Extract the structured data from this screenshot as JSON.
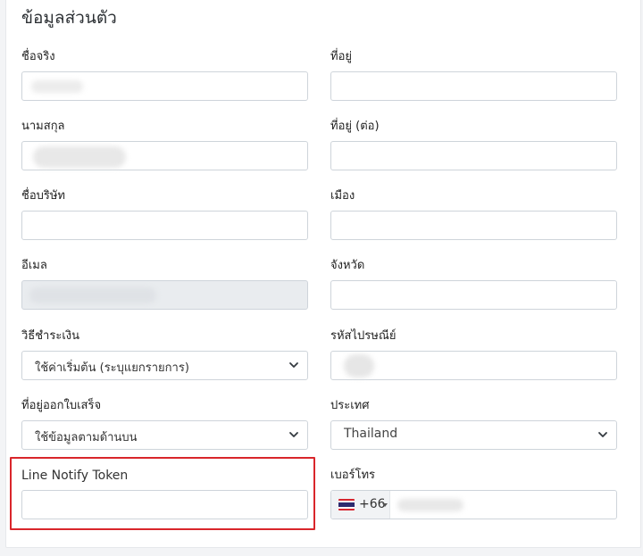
{
  "section_title": "ข้อมูลส่วนตัว",
  "fields": {
    "first_name": {
      "label": "ชื่อจริง",
      "value": ""
    },
    "last_name": {
      "label": "นามสกุล",
      "value": ""
    },
    "company": {
      "label": "ชื่อบริษัท",
      "value": ""
    },
    "email": {
      "label": "อีเมล",
      "value": ""
    },
    "payment_method": {
      "label": "วิธีชำระเงิน",
      "selected": "ใช้ค่าเริ่มต้น (ระบุแยกรายการ)"
    },
    "invoice_address": {
      "label": "ที่อยู่ออกใบเสร็จ",
      "selected": "ใช้ข้อมูลตามด้านบน"
    },
    "line_token": {
      "label": "Line Notify Token",
      "value": ""
    },
    "address1": {
      "label": "ที่อยู่",
      "value": ""
    },
    "address2": {
      "label": "ที่อยู่ (ต่อ)",
      "value": ""
    },
    "city": {
      "label": "เมือง",
      "value": ""
    },
    "province": {
      "label": "จังหวัด",
      "value": ""
    },
    "postcode": {
      "label": "รหัสไปรษณีย์",
      "value": ""
    },
    "country": {
      "label": "ประเทศ",
      "selected": "Thailand"
    },
    "phone": {
      "label": "เบอร์โทร",
      "dial_code": "+66",
      "value": ""
    }
  },
  "colors": {
    "highlight": "#d9262b",
    "border": "#ced4da",
    "disabled_bg": "#e9ecef",
    "flag_red": "#d6262f",
    "flag_white": "#ffffff",
    "flag_blue": "#2d2a6e"
  },
  "icons": {
    "select_chevron": "chevron-down-icon",
    "phone_flag": "thailand-flag-icon"
  }
}
